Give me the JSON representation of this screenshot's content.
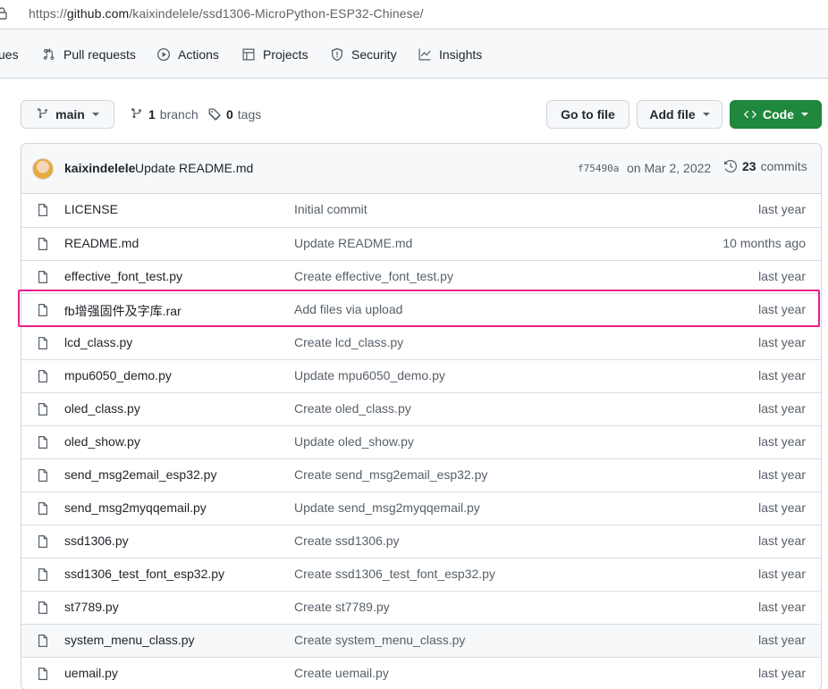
{
  "browser": {
    "url_prefix": "https://",
    "url_host": "github.com",
    "url_path": "/kaixindelele/ssd1306-MicroPython-ESP32-Chinese/"
  },
  "repo_nav": [
    {
      "label": "ues",
      "icon": "issues-icon"
    },
    {
      "label": "Pull requests",
      "icon": "pull-request-icon"
    },
    {
      "label": "Actions",
      "icon": "play-icon"
    },
    {
      "label": "Projects",
      "icon": "table-icon"
    },
    {
      "label": "Security",
      "icon": "shield-icon"
    },
    {
      "label": "Insights",
      "icon": "graph-icon"
    }
  ],
  "branch_bar": {
    "branch_name": "main",
    "branch_count": "1",
    "branch_word": "branch",
    "tag_count": "0",
    "tag_word": "tags",
    "go_to_file": "Go to file",
    "add_file": "Add file",
    "code": "Code"
  },
  "latest_commit": {
    "author": "kaixindelele",
    "message": "Update README.md",
    "sha": "f75490a",
    "date": "on Mar 2, 2022",
    "count": "23",
    "count_word": "commits"
  },
  "files": [
    {
      "name": "LICENSE",
      "message": "Initial commit",
      "age": "last year"
    },
    {
      "name": "README.md",
      "message": "Update README.md",
      "age": "10 months ago"
    },
    {
      "name": "effective_font_test.py",
      "message": "Create effective_font_test.py",
      "age": "last year"
    },
    {
      "name": "fb增强固件及字库.rar",
      "message": "Add files via upload",
      "age": "last year"
    },
    {
      "name": "lcd_class.py",
      "message": "Create lcd_class.py",
      "age": "last year"
    },
    {
      "name": "mpu6050_demo.py",
      "message": "Update mpu6050_demo.py",
      "age": "last year"
    },
    {
      "name": "oled_class.py",
      "message": "Create oled_class.py",
      "age": "last year"
    },
    {
      "name": "oled_show.py",
      "message": "Update oled_show.py",
      "age": "last year"
    },
    {
      "name": "send_msg2email_esp32.py",
      "message": "Create send_msg2email_esp32.py",
      "age": "last year"
    },
    {
      "name": "send_msg2myqqemail.py",
      "message": "Update send_msg2myqqemail.py",
      "age": "last year"
    },
    {
      "name": "ssd1306.py",
      "message": "Create ssd1306.py",
      "age": "last year"
    },
    {
      "name": "ssd1306_test_font_esp32.py",
      "message": "Create ssd1306_test_font_esp32.py",
      "age": "last year"
    },
    {
      "name": "st7789.py",
      "message": "Create st7789.py",
      "age": "last year"
    },
    {
      "name": "system_menu_class.py",
      "message": "Create system_menu_class.py",
      "age": "last year"
    },
    {
      "name": "uemail.py",
      "message": "Create uemail.py",
      "age": "last year"
    }
  ],
  "colors": {
    "highlight": "#e91e8c",
    "code_button": "#1f883d"
  }
}
